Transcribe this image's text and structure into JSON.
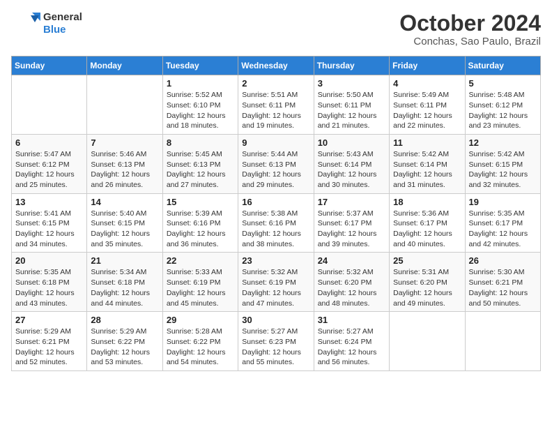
{
  "logo": {
    "text_general": "General",
    "text_blue": "Blue"
  },
  "title": "October 2024",
  "subtitle": "Conchas, Sao Paulo, Brazil",
  "days_of_week": [
    "Sunday",
    "Monday",
    "Tuesday",
    "Wednesday",
    "Thursday",
    "Friday",
    "Saturday"
  ],
  "weeks": [
    [
      {
        "day": "",
        "sunrise": "",
        "sunset": "",
        "daylight": ""
      },
      {
        "day": "",
        "sunrise": "",
        "sunset": "",
        "daylight": ""
      },
      {
        "day": "1",
        "sunrise": "Sunrise: 5:52 AM",
        "sunset": "Sunset: 6:10 PM",
        "daylight": "Daylight: 12 hours and 18 minutes."
      },
      {
        "day": "2",
        "sunrise": "Sunrise: 5:51 AM",
        "sunset": "Sunset: 6:11 PM",
        "daylight": "Daylight: 12 hours and 19 minutes."
      },
      {
        "day": "3",
        "sunrise": "Sunrise: 5:50 AM",
        "sunset": "Sunset: 6:11 PM",
        "daylight": "Daylight: 12 hours and 21 minutes."
      },
      {
        "day": "4",
        "sunrise": "Sunrise: 5:49 AM",
        "sunset": "Sunset: 6:11 PM",
        "daylight": "Daylight: 12 hours and 22 minutes."
      },
      {
        "day": "5",
        "sunrise": "Sunrise: 5:48 AM",
        "sunset": "Sunset: 6:12 PM",
        "daylight": "Daylight: 12 hours and 23 minutes."
      }
    ],
    [
      {
        "day": "6",
        "sunrise": "Sunrise: 5:47 AM",
        "sunset": "Sunset: 6:12 PM",
        "daylight": "Daylight: 12 hours and 25 minutes."
      },
      {
        "day": "7",
        "sunrise": "Sunrise: 5:46 AM",
        "sunset": "Sunset: 6:13 PM",
        "daylight": "Daylight: 12 hours and 26 minutes."
      },
      {
        "day": "8",
        "sunrise": "Sunrise: 5:45 AM",
        "sunset": "Sunset: 6:13 PM",
        "daylight": "Daylight: 12 hours and 27 minutes."
      },
      {
        "day": "9",
        "sunrise": "Sunrise: 5:44 AM",
        "sunset": "Sunset: 6:13 PM",
        "daylight": "Daylight: 12 hours and 29 minutes."
      },
      {
        "day": "10",
        "sunrise": "Sunrise: 5:43 AM",
        "sunset": "Sunset: 6:14 PM",
        "daylight": "Daylight: 12 hours and 30 minutes."
      },
      {
        "day": "11",
        "sunrise": "Sunrise: 5:42 AM",
        "sunset": "Sunset: 6:14 PM",
        "daylight": "Daylight: 12 hours and 31 minutes."
      },
      {
        "day": "12",
        "sunrise": "Sunrise: 5:42 AM",
        "sunset": "Sunset: 6:15 PM",
        "daylight": "Daylight: 12 hours and 32 minutes."
      }
    ],
    [
      {
        "day": "13",
        "sunrise": "Sunrise: 5:41 AM",
        "sunset": "Sunset: 6:15 PM",
        "daylight": "Daylight: 12 hours and 34 minutes."
      },
      {
        "day": "14",
        "sunrise": "Sunrise: 5:40 AM",
        "sunset": "Sunset: 6:15 PM",
        "daylight": "Daylight: 12 hours and 35 minutes."
      },
      {
        "day": "15",
        "sunrise": "Sunrise: 5:39 AM",
        "sunset": "Sunset: 6:16 PM",
        "daylight": "Daylight: 12 hours and 36 minutes."
      },
      {
        "day": "16",
        "sunrise": "Sunrise: 5:38 AM",
        "sunset": "Sunset: 6:16 PM",
        "daylight": "Daylight: 12 hours and 38 minutes."
      },
      {
        "day": "17",
        "sunrise": "Sunrise: 5:37 AM",
        "sunset": "Sunset: 6:17 PM",
        "daylight": "Daylight: 12 hours and 39 minutes."
      },
      {
        "day": "18",
        "sunrise": "Sunrise: 5:36 AM",
        "sunset": "Sunset: 6:17 PM",
        "daylight": "Daylight: 12 hours and 40 minutes."
      },
      {
        "day": "19",
        "sunrise": "Sunrise: 5:35 AM",
        "sunset": "Sunset: 6:17 PM",
        "daylight": "Daylight: 12 hours and 42 minutes."
      }
    ],
    [
      {
        "day": "20",
        "sunrise": "Sunrise: 5:35 AM",
        "sunset": "Sunset: 6:18 PM",
        "daylight": "Daylight: 12 hours and 43 minutes."
      },
      {
        "day": "21",
        "sunrise": "Sunrise: 5:34 AM",
        "sunset": "Sunset: 6:18 PM",
        "daylight": "Daylight: 12 hours and 44 minutes."
      },
      {
        "day": "22",
        "sunrise": "Sunrise: 5:33 AM",
        "sunset": "Sunset: 6:19 PM",
        "daylight": "Daylight: 12 hours and 45 minutes."
      },
      {
        "day": "23",
        "sunrise": "Sunrise: 5:32 AM",
        "sunset": "Sunset: 6:19 PM",
        "daylight": "Daylight: 12 hours and 47 minutes."
      },
      {
        "day": "24",
        "sunrise": "Sunrise: 5:32 AM",
        "sunset": "Sunset: 6:20 PM",
        "daylight": "Daylight: 12 hours and 48 minutes."
      },
      {
        "day": "25",
        "sunrise": "Sunrise: 5:31 AM",
        "sunset": "Sunset: 6:20 PM",
        "daylight": "Daylight: 12 hours and 49 minutes."
      },
      {
        "day": "26",
        "sunrise": "Sunrise: 5:30 AM",
        "sunset": "Sunset: 6:21 PM",
        "daylight": "Daylight: 12 hours and 50 minutes."
      }
    ],
    [
      {
        "day": "27",
        "sunrise": "Sunrise: 5:29 AM",
        "sunset": "Sunset: 6:21 PM",
        "daylight": "Daylight: 12 hours and 52 minutes."
      },
      {
        "day": "28",
        "sunrise": "Sunrise: 5:29 AM",
        "sunset": "Sunset: 6:22 PM",
        "daylight": "Daylight: 12 hours and 53 minutes."
      },
      {
        "day": "29",
        "sunrise": "Sunrise: 5:28 AM",
        "sunset": "Sunset: 6:22 PM",
        "daylight": "Daylight: 12 hours and 54 minutes."
      },
      {
        "day": "30",
        "sunrise": "Sunrise: 5:27 AM",
        "sunset": "Sunset: 6:23 PM",
        "daylight": "Daylight: 12 hours and 55 minutes."
      },
      {
        "day": "31",
        "sunrise": "Sunrise: 5:27 AM",
        "sunset": "Sunset: 6:24 PM",
        "daylight": "Daylight: 12 hours and 56 minutes."
      },
      {
        "day": "",
        "sunrise": "",
        "sunset": "",
        "daylight": ""
      },
      {
        "day": "",
        "sunrise": "",
        "sunset": "",
        "daylight": ""
      }
    ]
  ]
}
